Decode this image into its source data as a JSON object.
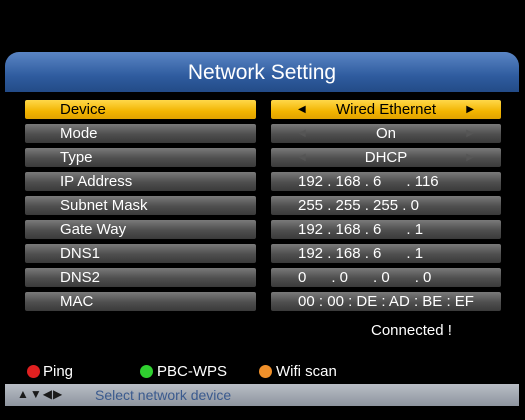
{
  "header": {
    "title": "Network Setting"
  },
  "rows": [
    {
      "label": "Device",
      "value": "Wired Ethernet"
    },
    {
      "label": "Mode",
      "value": "On"
    },
    {
      "label": "Type",
      "value": "DHCP"
    },
    {
      "label": "IP Address",
      "value": "192 . 168 . 6      . 116"
    },
    {
      "label": "Subnet Mask",
      "value": "255 . 255 . 255 . 0"
    },
    {
      "label": "Gate Way",
      "value": "192 . 168 . 6      . 1"
    },
    {
      "label": "DNS1",
      "value": "192 . 168 . 6      . 1"
    },
    {
      "label": "DNS2",
      "value": "0      . 0      . 0      . 0"
    },
    {
      "label": "MAC",
      "value": "00 : 00 : DE : AD : BE : EF"
    }
  ],
  "status": "Connected !",
  "legend": {
    "ping": {
      "label": "Ping",
      "color": "#e02020"
    },
    "pbc_wps": {
      "label": "PBC-WPS",
      "color": "#2fd02f"
    },
    "wifi_scan": {
      "label": "Wifi scan",
      "color": "#f0902a"
    }
  },
  "hint": {
    "icons": "left-right-up-down-arrow-icons",
    "text": "Select network device"
  },
  "colors": {
    "selected": "#f2b400",
    "header": "#2f5c9f",
    "row": "#5a5a5a"
  }
}
